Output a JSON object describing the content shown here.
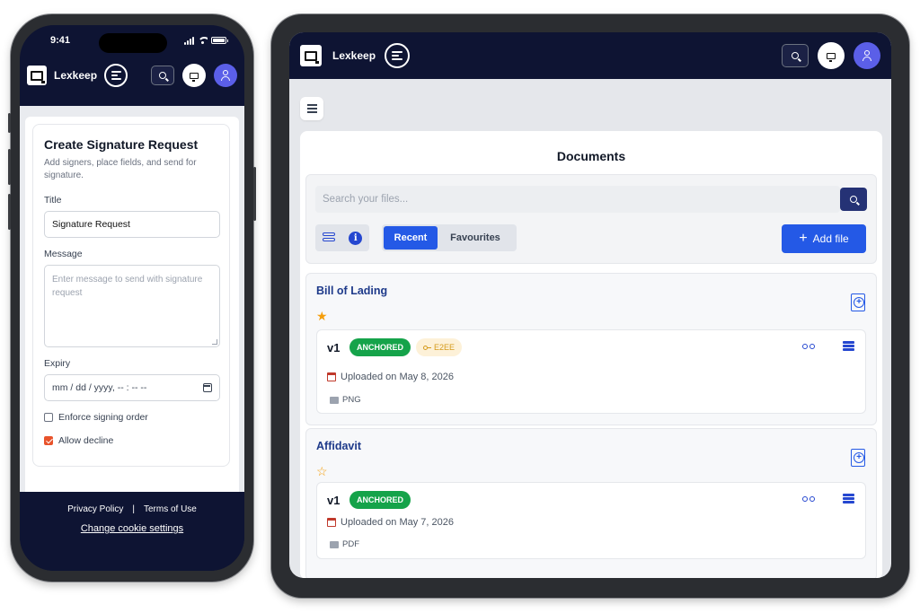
{
  "phone": {
    "status": {
      "time": "9:41"
    },
    "header": {
      "brand": "Lexkeep"
    },
    "form": {
      "title": "Create Signature Request",
      "subtitle": "Add signers, place fields, and send for signature.",
      "title_label": "Title",
      "title_value": "Signature Request",
      "message_label": "Message",
      "message_placeholder": "Enter message to send with signature request",
      "expiry_label": "Expiry",
      "expiry_placeholder": "mm / dd / yyyy,  -- : --  --",
      "enforce_label": "Enforce signing order",
      "enforce_checked": false,
      "decline_label": "Allow decline",
      "decline_checked": true
    },
    "footer": {
      "privacy": "Privacy Policy",
      "separator": "|",
      "terms": "Terms of Use",
      "cookie": "Change cookie settings"
    }
  },
  "tablet": {
    "header": {
      "brand": "Lexkeep"
    },
    "documents": {
      "title": "Documents",
      "search_placeholder": "Search your files...",
      "tabs": [
        {
          "label": "Recent",
          "active": true
        },
        {
          "label": "Favourites",
          "active": false
        }
      ],
      "add_file": "Add file",
      "items": [
        {
          "name": "Bill of Lading",
          "favourite": true,
          "star": "★",
          "version": "v1",
          "badges": [
            "ANCHORED",
            "E2EE"
          ],
          "uploaded": "Uploaded on May 8, 2026",
          "file_type": "PNG"
        },
        {
          "name": "Affidavit",
          "favourite": false,
          "star": "☆",
          "version": "v1",
          "badges": [
            "ANCHORED"
          ],
          "uploaded": "Uploaded on May 7, 2026",
          "file_type": "PDF"
        }
      ]
    }
  },
  "icons": {
    "logo": "lexkeep-logo-icon",
    "menu": "menu-icon",
    "search": "search-icon",
    "monitor": "monitor-icon",
    "user": "user-icon",
    "list_view": "list-view-icon",
    "info": "info-icon",
    "add_document": "add-document-icon",
    "binoculars": "binoculars-icon",
    "server": "server-icon",
    "calendar": "calendar-icon",
    "key": "key-icon"
  },
  "colors": {
    "header_bg": "#0e1433",
    "primary": "#2459e6",
    "anchored": "#15a34a",
    "e2ee_bg": "#fdf1d8",
    "e2ee_text": "#d59a1b",
    "star": "#f59e0b",
    "avatar": "#5b5fe8",
    "checkbox_on": "#e8532b"
  }
}
